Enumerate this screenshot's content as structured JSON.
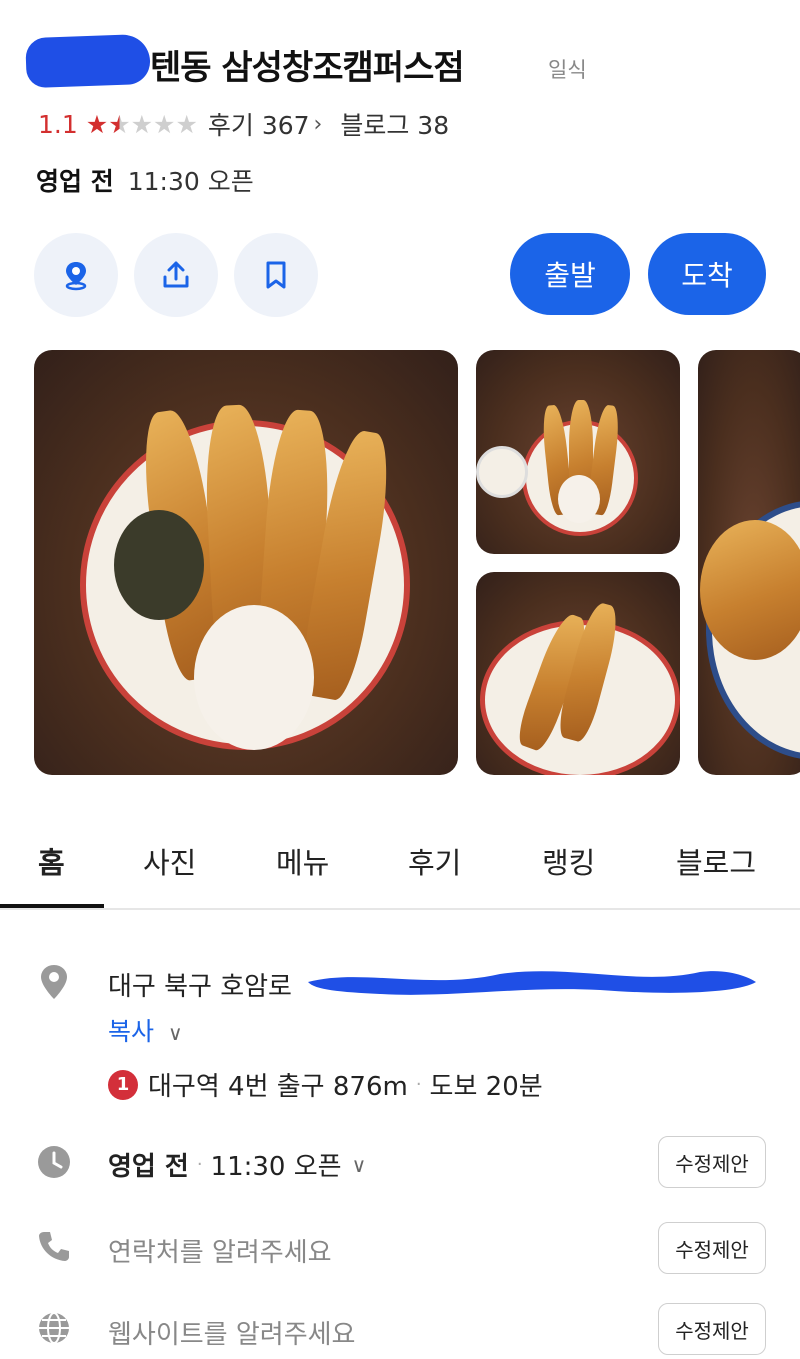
{
  "header": {
    "title": "텐동 삼성창조캠퍼스점",
    "category": "일식",
    "rating": "1.1",
    "stars": {
      "value": 1.5,
      "max": 5
    },
    "reviews_label": "후기 367",
    "blog_label": "블로그 38",
    "status": "영업 전",
    "open_time": "11:30 오픈"
  },
  "actions": {
    "depart": "출발",
    "arrive": "도착",
    "icons": [
      "map-pin-icon",
      "share-icon",
      "bookmark-icon"
    ]
  },
  "tabs": [
    "홈",
    "사진",
    "메뉴",
    "후기",
    "랭킹",
    "블로그"
  ],
  "info": {
    "address": "대구 북구 호암로",
    "copy_label": "복사",
    "subway_line": "1",
    "subway_text": "대구역 4번 출구 876m",
    "walk_text": "도보 20분",
    "hours_status": "영업 전",
    "hours_open": "11:30 오픈",
    "phone_placeholder": "연락처를 알려주세요",
    "website_placeholder": "웹사이트를 알려주세요",
    "suggest_label": "수정제안"
  },
  "colors": {
    "accent": "#1b64e8",
    "rating": "#d32f2f",
    "redaction": "#1f4fe6"
  }
}
